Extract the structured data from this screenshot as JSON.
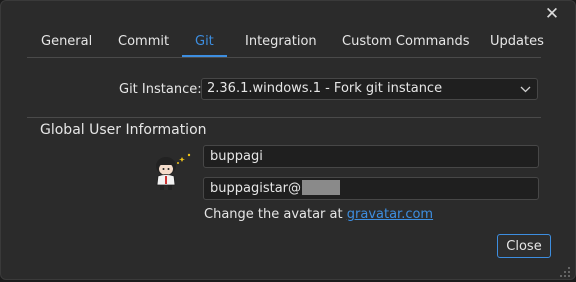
{
  "window": {
    "close_glyph": "✕"
  },
  "tabs": [
    {
      "label": "General"
    },
    {
      "label": "Commit"
    },
    {
      "label": "Git",
      "active": true
    },
    {
      "label": "Integration"
    },
    {
      "label": "Custom Commands"
    },
    {
      "label": "Updates"
    }
  ],
  "git_instance": {
    "label": "Git Instance:",
    "selected": "2.36.1.windows.1 - Fork git instance"
  },
  "user_info": {
    "section_title": "Global User Information",
    "name_value": "buppagi",
    "email_value": "buppagistar@",
    "avatar_text": "Change the avatar at",
    "avatar_link": "gravatar.com"
  },
  "footer": {
    "close_label": "Close"
  },
  "colors": {
    "accent": "#3d8ee0",
    "background": "#2b2b2b",
    "input_bg": "#1f1f1f"
  },
  "icons": [
    "close-icon",
    "chevron-down-icon",
    "avatar-icon",
    "resize-grip-icon"
  ]
}
